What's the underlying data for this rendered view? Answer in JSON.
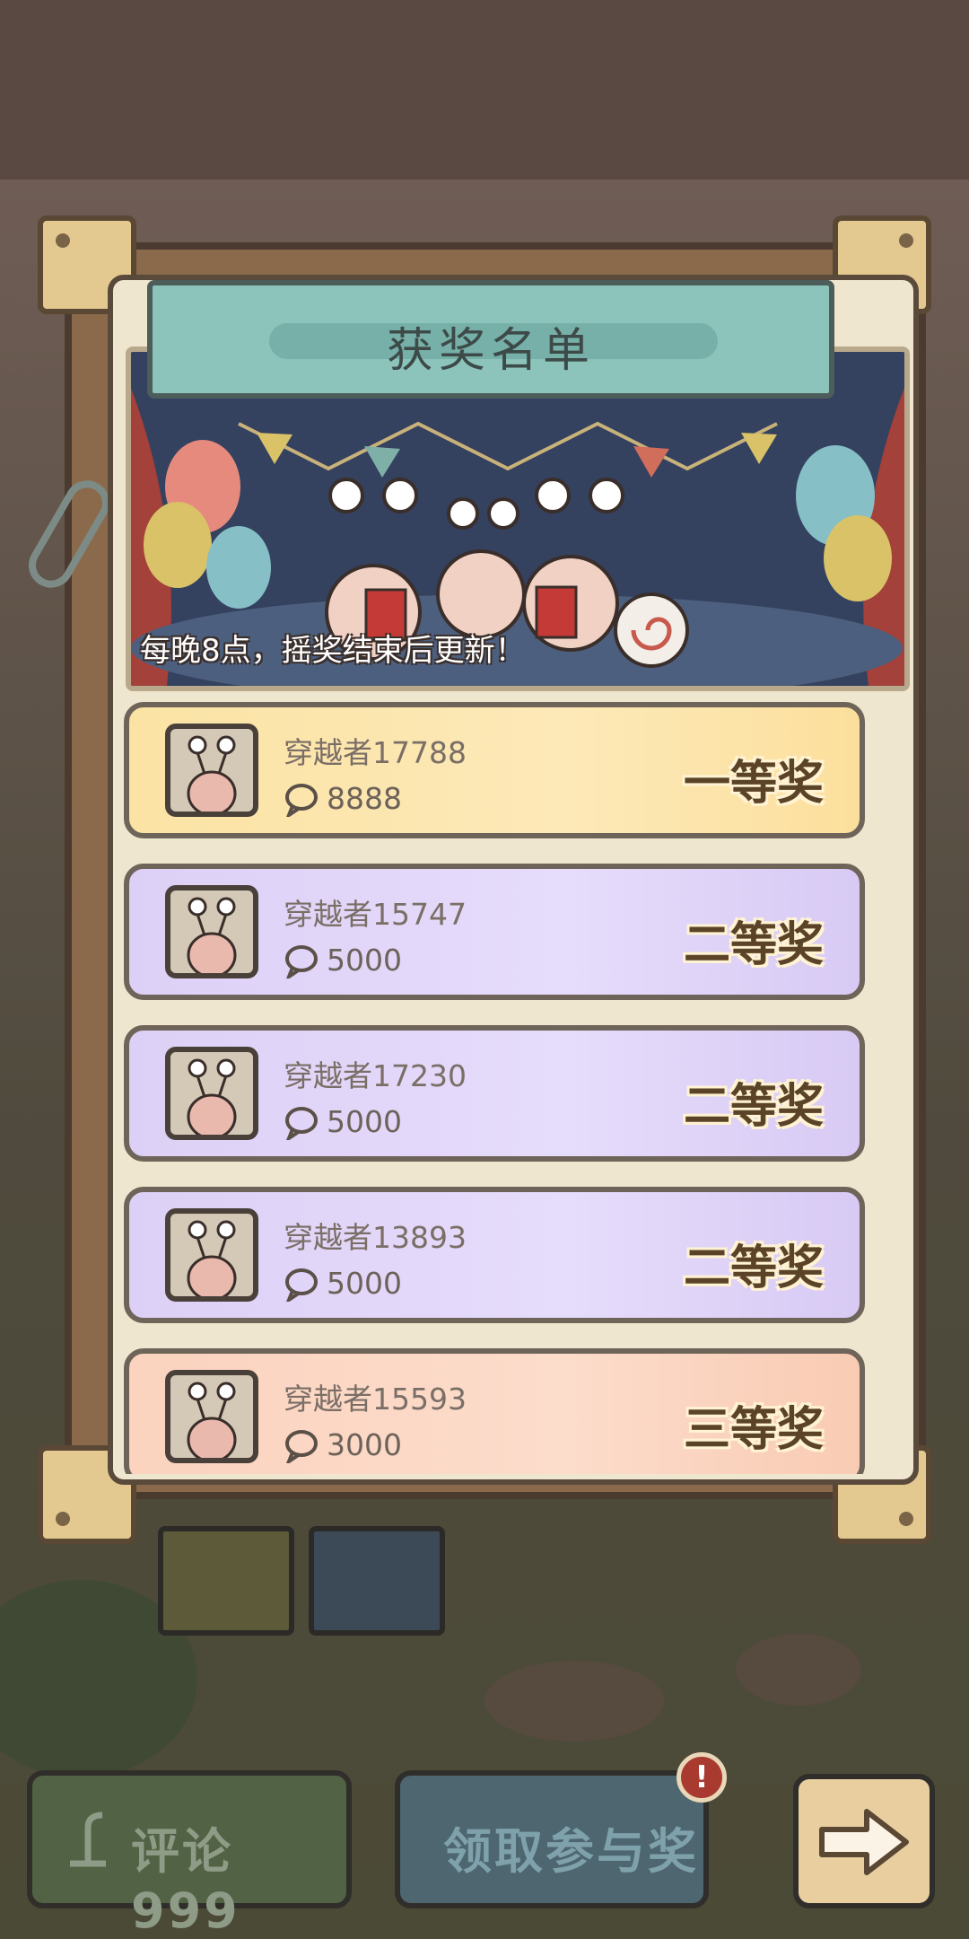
{
  "modal": {
    "title": "获奖名单",
    "banner_caption": "每晚8点，摇奖结束后更新！"
  },
  "winners": [
    {
      "name": "穿越者17788",
      "amount": "8888",
      "prize": "一等奖",
      "tier": "first"
    },
    {
      "name": "穿越者15747",
      "amount": "5000",
      "prize": "二等奖",
      "tier": "second"
    },
    {
      "name": "穿越者17230",
      "amount": "5000",
      "prize": "二等奖",
      "tier": "second"
    },
    {
      "name": "穿越者13893",
      "amount": "5000",
      "prize": "二等奖",
      "tier": "second"
    },
    {
      "name": "穿越者15593",
      "amount": "3000",
      "prize": "三等奖",
      "tier": "third"
    }
  ],
  "bottom_bar": {
    "comment_label": "评论",
    "comment_count": "999",
    "claim_label": "领取参与奖",
    "claim_badge": "!",
    "next_icon": "arrow-right-icon"
  },
  "colors": {
    "first_prize_bg": "#fde9b8",
    "second_prize_bg": "#e6dcfb",
    "third_prize_bg": "#fcdccb",
    "title_plate": "#8cc4bb"
  }
}
